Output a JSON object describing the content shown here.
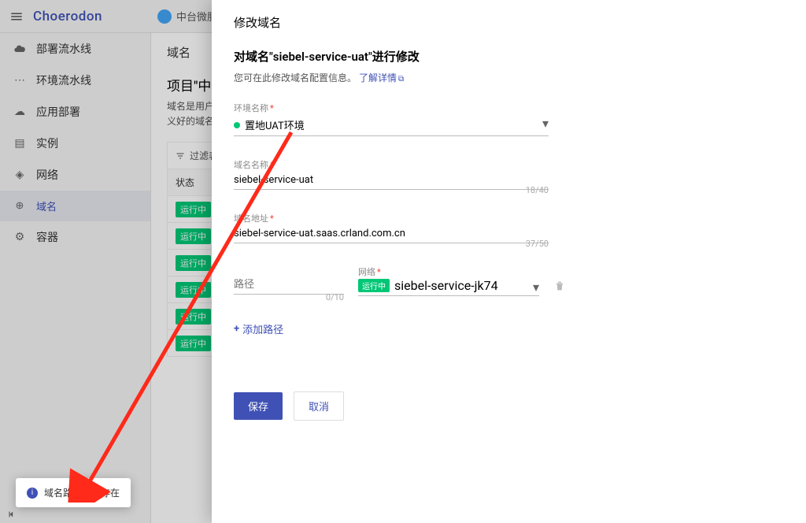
{
  "brand": "Choerodon",
  "breadcrumb": {
    "project": "中台微服"
  },
  "sidebar": {
    "group": "部署流水线",
    "items": [
      "环境流水线",
      "应用部署",
      "实例",
      "网络",
      "域名",
      "容器"
    ],
    "activeIndex": 4
  },
  "page": {
    "section": "域名",
    "titlePrefix": "项目\"中台",
    "desc1": "域名是用户通",
    "desc2": "义好的域名，",
    "filterLabel": "过滤表",
    "statusHeader": "状态",
    "rowBadge": "运行中",
    "rowCount": 6
  },
  "drawer": {
    "title": "修改域名",
    "heading": "对域名\"siebel-service-uat\"进行修改",
    "sub": "您可在此修改域名配置信息。",
    "learnMore": "了解详情",
    "env": {
      "label": "环境名称",
      "value": "置地UAT环境"
    },
    "name": {
      "label": "域名名称",
      "value": "siebel-service-uat",
      "counter": "18/40"
    },
    "addr": {
      "label": "域名地址",
      "value": "siebel-service-uat.saas.crland.com.cn",
      "counter": "37/50"
    },
    "path": {
      "label": "路径",
      "value": "",
      "counter": "0/10"
    },
    "net": {
      "label": "网络",
      "badge": "运行中",
      "value": "siebel-service-jk74"
    },
    "addPath": "添加路径",
    "save": "保存",
    "cancel": "取消"
  },
  "toast": {
    "text": "域名路径已经存在"
  }
}
